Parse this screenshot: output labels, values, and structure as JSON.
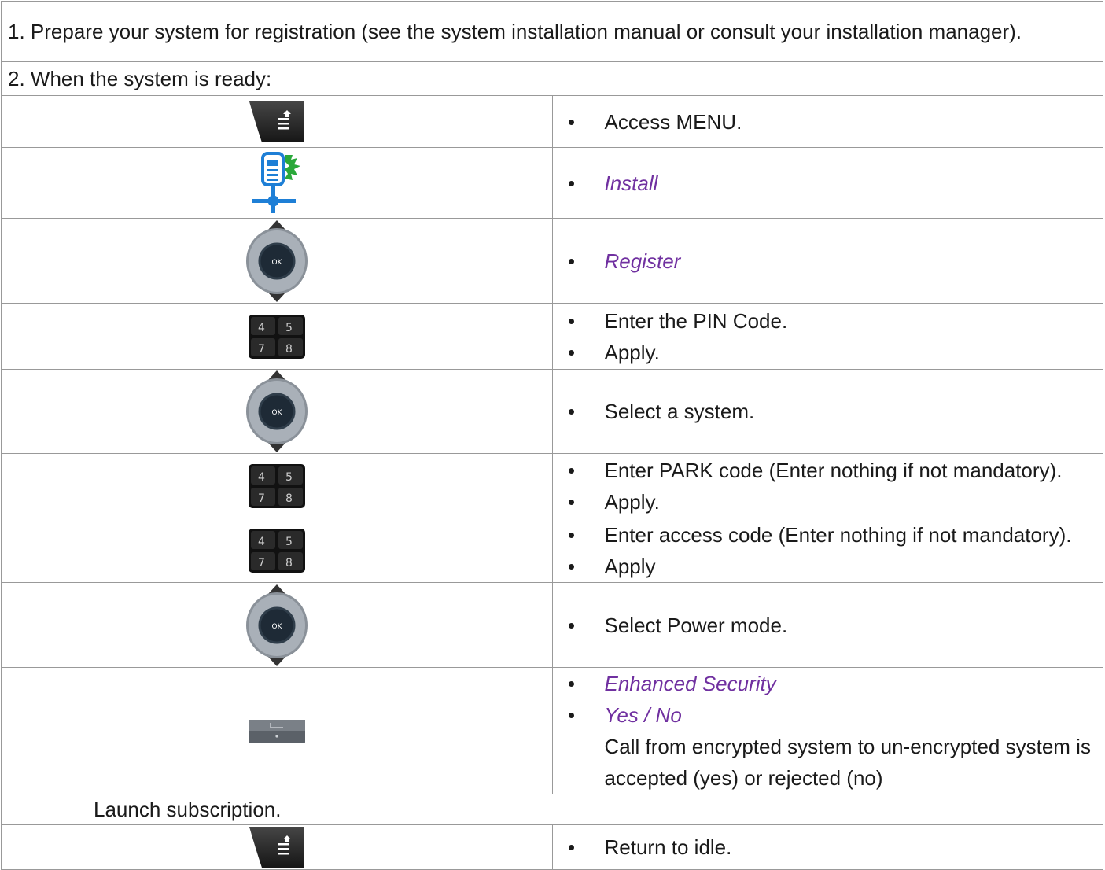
{
  "intro": {
    "step1": "1. Prepare your system for registration (see the system installation manual or consult your installation manager).",
    "step2": "2. When the system is ready:"
  },
  "rows": [
    {
      "icon": "menu-key-icon",
      "items": [
        "Access MENU."
      ]
    },
    {
      "icon": "install-icon",
      "items": [
        "Install"
      ]
    },
    {
      "icon": "navigator-icon",
      "items": [
        "Register"
      ]
    },
    {
      "icon": "keypad-icon",
      "items": [
        "Enter the PIN Code.",
        "Apply."
      ]
    },
    {
      "icon": "navigator-icon",
      "items": [
        "Select a system."
      ]
    },
    {
      "icon": "keypad-icon",
      "items": [
        "Enter PARK code (Enter nothing if not mandatory).",
        "Apply."
      ]
    },
    {
      "icon": "keypad-icon",
      "items": [
        "Enter access code (Enter nothing if not mandatory).",
        "Apply"
      ]
    },
    {
      "icon": "navigator-icon",
      "items": [
        "Select Power mode."
      ]
    },
    {
      "icon": "softkey-icon",
      "items": [
        "Enhanced Security",
        "Yes / No",
        "Call from encrypted system to un-encrypted system is accepted (yes) or rejected (no)"
      ]
    }
  ],
  "launch": "Launch subscription.",
  "last_row": {
    "icon": "menu-key-icon",
    "items": [
      "Return to idle."
    ]
  },
  "colors": {
    "accent_text": "#7030a0",
    "border": "#999999",
    "install_blue": "#1e7fd6",
    "install_green": "#2aa83a"
  }
}
